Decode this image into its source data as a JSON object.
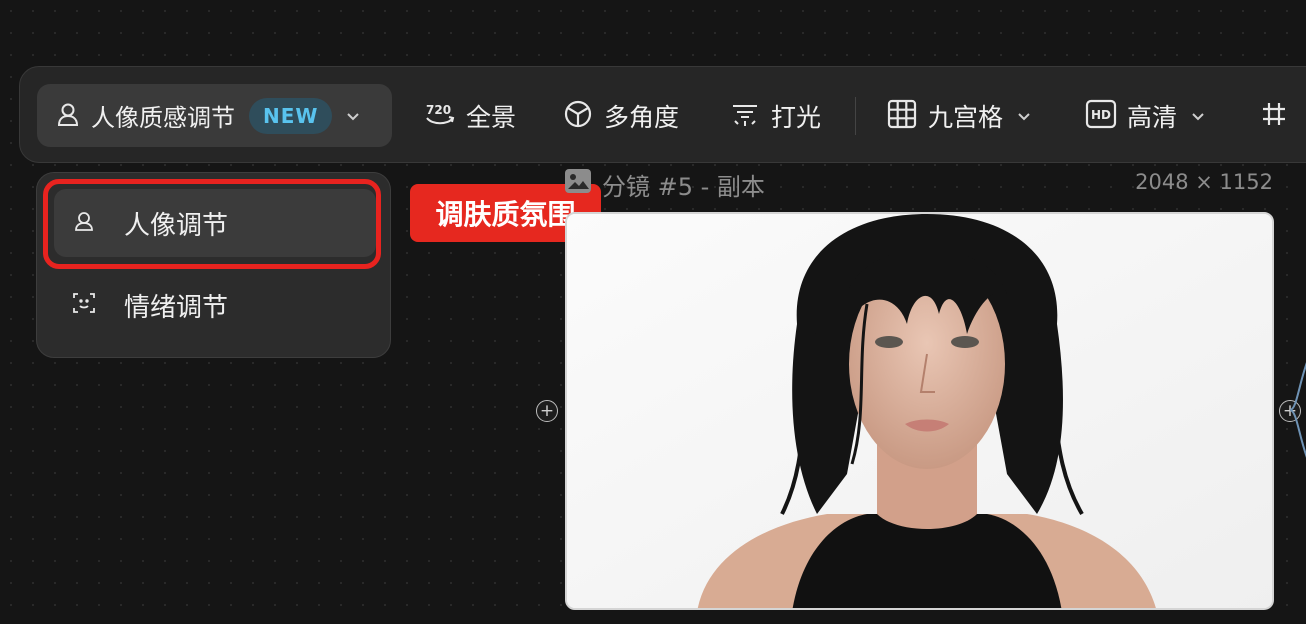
{
  "toolbar": {
    "active_tool": {
      "label": "人像质感调节",
      "badge": "NEW"
    },
    "tools": [
      {
        "label": "全景",
        "icon": "720-panorama-icon"
      },
      {
        "label": "多角度",
        "icon": "multi-angle-icon"
      },
      {
        "label": "打光",
        "icon": "lighting-icon"
      },
      {
        "label": "九宫格",
        "icon": "grid-icon"
      },
      {
        "label": "高清",
        "icon": "hd-icon"
      }
    ]
  },
  "dropdown": {
    "items": [
      {
        "label": "人像调节",
        "icon": "portrait-icon",
        "selected": true
      },
      {
        "label": "情绪调节",
        "icon": "face-scan-icon",
        "selected": false
      }
    ]
  },
  "annotation": {
    "text": "调肤质氛围",
    "color": "#e6281f"
  },
  "node": {
    "title": "分镜 #5 - 副本",
    "size": "2048 × 1152"
  },
  "colors": {
    "accent_badge_text": "#59c3ee",
    "accent_badge_bg": "#2f4d5b",
    "highlight": "#e8231f"
  }
}
